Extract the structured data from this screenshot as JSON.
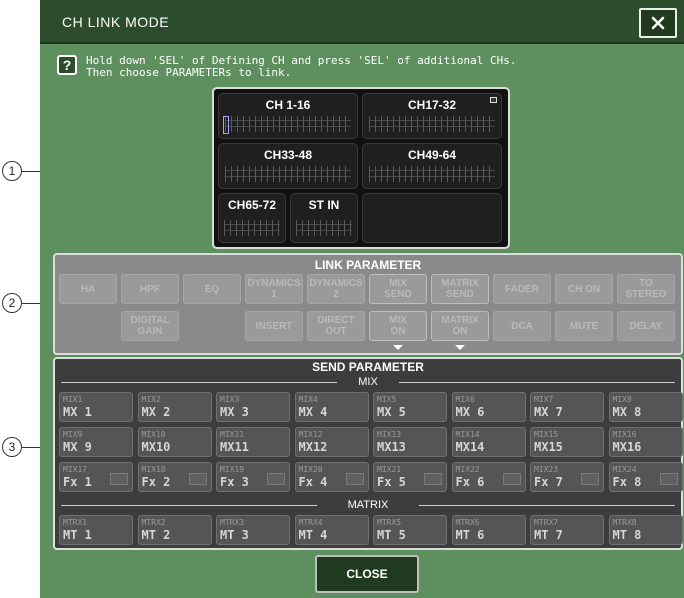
{
  "dialog": {
    "title": "CH LINK MODE",
    "close_glyph": "✕",
    "help_glyph": "?",
    "instruction": "Hold down 'SEL' of Defining CH and press 'SEL' of additional CHs.\nThen choose PARAMETERs to link."
  },
  "channel_grid": [
    "CH 1-16",
    "CH17-32",
    "CH33-48",
    "CH49-64",
    "CH65-72",
    "ST IN"
  ],
  "link_parameter": {
    "title": "LINK PARAMETER",
    "row1": [
      "HA",
      "HPF",
      "EQ",
      "DYNAMICS\n1",
      "DYNAMICS\n2",
      "MIX\nSEND",
      "MATRIX\nSEND",
      "FADER",
      "CH ON",
      "TO\nSTEREO"
    ],
    "row2": [
      "DIGITAL\nGAIN",
      "INSERT",
      "DIRECT\nOUT",
      "MIX\nON",
      "MATRIX\nON",
      "DCA",
      "MUTE",
      "DELAY"
    ]
  },
  "send_parameter": {
    "title": "SEND PARAMETER",
    "mix_label": "MIX",
    "matrix_label": "MATRIX",
    "mix_rows": [
      [
        [
          "MIX1",
          "MX 1"
        ],
        [
          "MIX2",
          "MX 2"
        ],
        [
          "MIX3",
          "MX 3"
        ],
        [
          "MIX4",
          "MX 4"
        ],
        [
          "MIX5",
          "MX 5"
        ],
        [
          "MIX6",
          "MX 6"
        ],
        [
          "MIX7",
          "MX 7"
        ],
        [
          "MIX8",
          "MX 8"
        ]
      ],
      [
        [
          "MIX9",
          "MX 9"
        ],
        [
          "MIX10",
          "MX10"
        ],
        [
          "MIX11",
          "MX11"
        ],
        [
          "MIX12",
          "MX12"
        ],
        [
          "MIX13",
          "MX13"
        ],
        [
          "MIX14",
          "MX14"
        ],
        [
          "MIX15",
          "MX15"
        ],
        [
          "MIX16",
          "MX16"
        ]
      ],
      [
        [
          "MIX17",
          "Fx 1"
        ],
        [
          "MIX18",
          "Fx 2"
        ],
        [
          "MIX19",
          "Fx 3"
        ],
        [
          "MIX20",
          "Fx 4"
        ],
        [
          "MIX21",
          "Fx 5"
        ],
        [
          "MIX22",
          "Fx 6"
        ],
        [
          "MIX23",
          "Fx 7"
        ],
        [
          "MIX24",
          "Fx 8"
        ]
      ]
    ],
    "matrix_row": [
      [
        "MTRX1",
        "MT 1"
      ],
      [
        "MTRX2",
        "MT 2"
      ],
      [
        "MTRX3",
        "MT 3"
      ],
      [
        "MTRX4",
        "MT 4"
      ],
      [
        "MTRX5",
        "MT 5"
      ],
      [
        "MTRX6",
        "MT 6"
      ],
      [
        "MTRX7",
        "MT 7"
      ],
      [
        "MTRX8",
        "MT 8"
      ]
    ]
  },
  "close_button": "CLOSE",
  "callouts": [
    "1",
    "2",
    "3"
  ],
  "colors": {
    "dialog_bg": "#5e8f5e",
    "titlebar": "#2c4d2c",
    "link_section_bg": "#8a8a8a",
    "send_section_bg": "#3d3d3d"
  }
}
